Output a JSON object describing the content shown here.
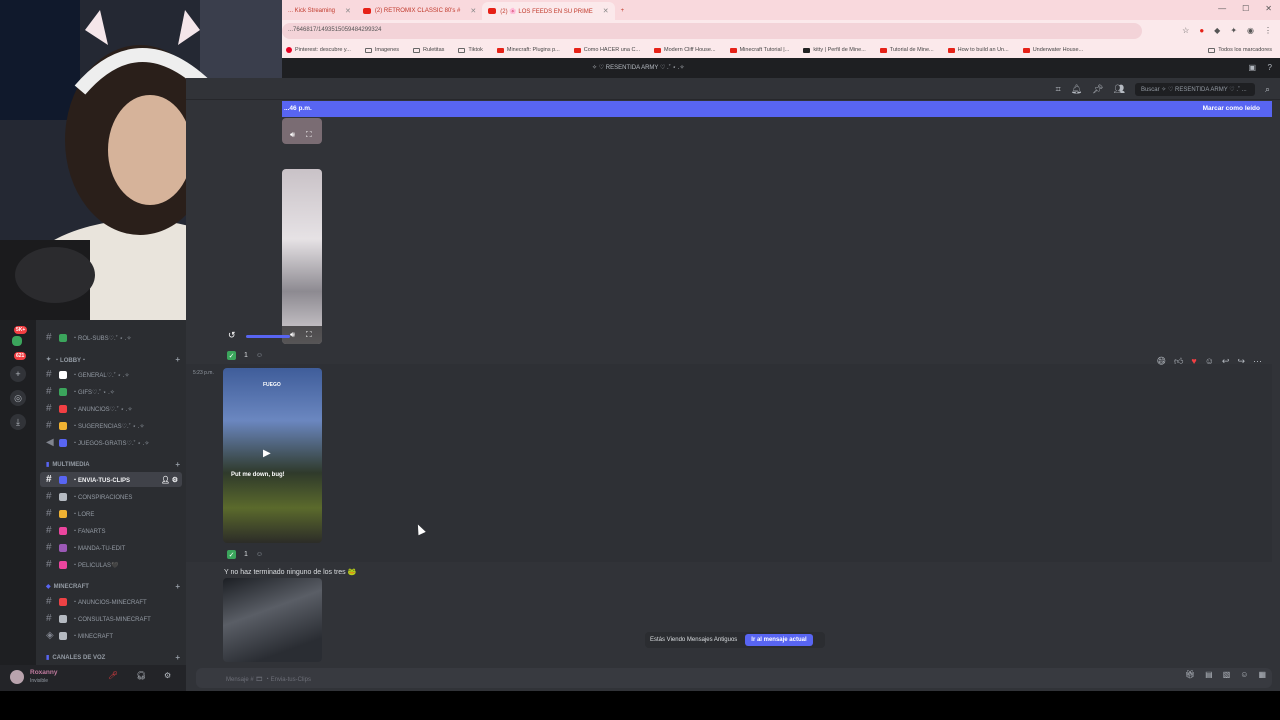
{
  "browser": {
    "tabs": [
      {
        "label": "... Kick Streaming",
        "active": false,
        "icon": "kick-icon"
      },
      {
        "label": "(2) RETROMIX CLASSIC 80's #",
        "active": false,
        "icon": "youtube-icon"
      },
      {
        "label": "(2) 🌸 LOS FEEDS EN SU PRIME",
        "active": true,
        "icon": "youtube-icon"
      }
    ],
    "new_tab": "+",
    "url": "...7646817/1493515059484299324",
    "bookmarks": [
      {
        "label": "Pinterest: descubre y...",
        "icon": "pinterest"
      },
      {
        "label": "Imagenes",
        "icon": "folder"
      },
      {
        "label": "Ruletitas",
        "icon": "folder"
      },
      {
        "label": "Tiktok",
        "icon": "folder"
      },
      {
        "label": "Minecraft: Plugins p...",
        "icon": "youtube"
      },
      {
        "label": "Como HACER una C...",
        "icon": "youtube"
      },
      {
        "label": "Modern Cliff House...",
        "icon": "youtube"
      },
      {
        "label": "Minecraft Tutorial |...",
        "icon": "youtube"
      },
      {
        "label": "kitty | Perfil de Mine...",
        "icon": "youtube"
      },
      {
        "label": "Tutorial de Mine...",
        "icon": "youtube"
      },
      {
        "label": "How to build an Un...",
        "icon": "youtube"
      },
      {
        "label": "Underwater House...",
        "icon": "youtube"
      }
    ],
    "all_bookmarks": "Todos los marcadores"
  },
  "discord": {
    "server_title": "✧ ♡ RESENTIDA ARMY ♡ .˚ ⋆ .✧",
    "search_placeholder": "Buscar ✧ ♡ RESENTIDA ARMY ♡ .˚ ...",
    "banner": {
      "left": "...46 p.m.",
      "right": "Marcar como leído"
    },
    "server_badges": {
      "top": "5K+",
      "count": "621"
    },
    "channels": {
      "pre_items": [
        {
          "label": "・ROL-SUBS♡.˚ ⋆ .✧",
          "color": "#3ba55c"
        }
      ],
      "categories": [
        {
          "name": "・LOBBY・",
          "items": [
            {
              "label": "・GENERAL♡.˚ ⋆ .✧",
              "color": "#ffffff",
              "voice": false
            },
            {
              "label": "・GIFS♡.˚ ⋆ .✧",
              "color": "#3ba55c",
              "voice": false
            },
            {
              "label": "・ANUNCIOS♡.˚ ⋆ .✧",
              "color": "#f23f43",
              "voice": false
            },
            {
              "label": "・SUGERENCIAS♡.˚ ⋆ .✧",
              "color": "#f0b232",
              "voice": false
            },
            {
              "label": "・JUEGOS-GRATIS♡.˚ ⋆ .✧",
              "color": "#5865f2",
              "voice": false
            }
          ]
        },
        {
          "name": "MULTIMEDIA",
          "items": [
            {
              "label": "・ENVIA-TUS-CLIPS",
              "color": "#5865f2",
              "active": true
            },
            {
              "label": "・CONSPIRACIONES",
              "color": "#b5bac1"
            },
            {
              "label": "・LORE",
              "color": "#f0b232"
            },
            {
              "label": "・FANARTS",
              "color": "#eb459e"
            },
            {
              "label": "・MANDA-TU-EDIT",
              "color": "#9b59b6"
            },
            {
              "label": "・PELICULAS🖤",
              "color": "#eb459e"
            }
          ]
        },
        {
          "name": "MINECRAFT",
          "items": [
            {
              "label": "・ANUNCIOS-MINECRAFT",
              "color": "#ed4245"
            },
            {
              "label": "・CONSULTAS-MINECRAFT",
              "color": "#b5bac1"
            },
            {
              "label": "・MINECRAFT",
              "color": "#b5bac1"
            }
          ]
        },
        {
          "name": "CANALES DE VOZ",
          "items": []
        }
      ]
    },
    "messages": {
      "timestamp": "5:23 p.m.",
      "reaction_count_1": "1",
      "reaction_count_2": "1",
      "video_caption_top": "FUEGO",
      "video_caption_mid": "Put me down, bug!",
      "text": "Y no haz terminado ninguno de los tres",
      "text_emoji": "🐸"
    },
    "old_messages": {
      "label": "Estás Viendo Mensajes Antiguos",
      "jump": "Ir al mensaje actual"
    },
    "composer_placeholder": "Mensaje # 🎞 ・Envia-tus-Clips",
    "user": {
      "name": "Roxanny",
      "status": "Invisible"
    }
  }
}
